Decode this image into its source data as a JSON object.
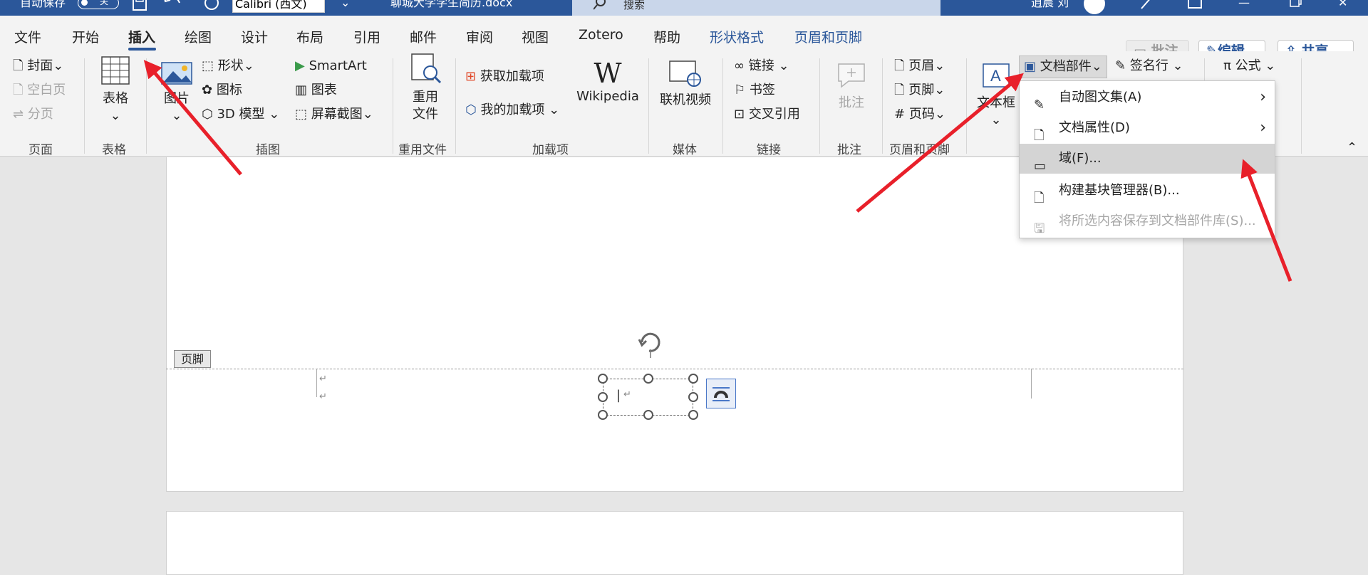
{
  "titlebar": {
    "autosave_label": "自动保存",
    "autosave_state": "关",
    "font_name": "Calibri (西文)",
    "doc_title": "聊城大学学生简历.docx",
    "search_placeholder": "搜索",
    "user": "逍晨 刘"
  },
  "tabs": [
    {
      "label": "文件"
    },
    {
      "label": "开始"
    },
    {
      "label": "插入"
    },
    {
      "label": "绘图"
    },
    {
      "label": "设计"
    },
    {
      "label": "布局"
    },
    {
      "label": "引用"
    },
    {
      "label": "邮件"
    },
    {
      "label": "审阅"
    },
    {
      "label": "视图"
    },
    {
      "label": "Zotero"
    },
    {
      "label": "帮助"
    },
    {
      "label": "形状格式"
    },
    {
      "label": "页眉和页脚"
    }
  ],
  "right_buttons": {
    "comment": "批注",
    "edit": "编辑",
    "share": "共享"
  },
  "ribbon": {
    "pages": {
      "cover": "封面",
      "blank": "空白页",
      "break": "分页",
      "group": "页面"
    },
    "table": {
      "label": "表格",
      "group": "表格"
    },
    "illustrations": {
      "picture": "图片",
      "shapes": "形状",
      "icons": "图标",
      "model3d": "3D 模型",
      "smartart": "SmartArt",
      "chart": "图表",
      "screenshot": "屏幕截图",
      "group": "插图"
    },
    "reuse": {
      "label1": "重用",
      "label2": "文件",
      "group": "重用文件"
    },
    "addins": {
      "get": "获取加载项",
      "my": "我的加载项",
      "wikipedia": "Wikipedia",
      "group": "加载项"
    },
    "media": {
      "video": "联机视频",
      "group": "媒体"
    },
    "links": {
      "link": "链接",
      "bookmark": "书签",
      "crossref": "交叉引用",
      "group": "链接"
    },
    "comments": {
      "comment": "批注",
      "group": "批注"
    },
    "hf": {
      "header": "页眉",
      "footer": "页脚",
      "pagenum": "页码",
      "group": "页眉和页脚"
    },
    "text": {
      "textbox": "文本框",
      "quickparts": "文档部件",
      "signature": "签名行"
    },
    "symbols": {
      "equation": "公式"
    }
  },
  "menu": {
    "items": [
      {
        "label": "自动图文集(A)",
        "submenu": true
      },
      {
        "label": "文档属性(D)",
        "submenu": true
      },
      {
        "label": "域(F)...",
        "highlighted": true
      },
      {
        "label": "构建基块管理器(B)..."
      },
      {
        "label": "将所选内容保存到文档部件库(S)...",
        "disabled": true
      }
    ]
  },
  "document": {
    "footer_label": "页脚"
  },
  "colors": {
    "accent": "#2b579a",
    "arrow": "#e8202a"
  }
}
